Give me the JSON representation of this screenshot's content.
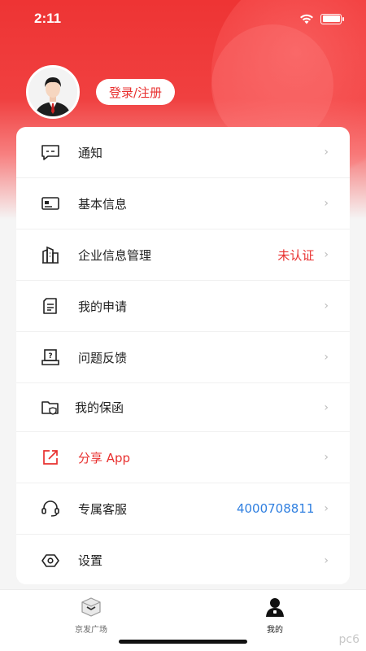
{
  "status_bar": {
    "time": "2:11"
  },
  "profile": {
    "login_label": "登录/注册"
  },
  "menu": [
    {
      "label": "通知",
      "value": "",
      "icon": "message-icon"
    },
    {
      "label": "基本信息",
      "value": "",
      "icon": "id-card-icon"
    },
    {
      "label": "企业信息管理",
      "value": "未认证",
      "value_color": "#e8302f",
      "icon": "building-icon"
    },
    {
      "label": "我的申请",
      "value": "",
      "icon": "document-icon"
    },
    {
      "label": "问题反馈",
      "value": "",
      "icon": "feedback-icon"
    },
    {
      "label": "我的保函",
      "value": "",
      "icon": "folder-shield-icon"
    },
    {
      "label": "分享 App",
      "value": "",
      "label_color": "#e8302f",
      "icon": "share-icon"
    },
    {
      "label": "专属客服",
      "value": "4000708811",
      "value_color": "#2f7fe0",
      "icon": "headset-icon"
    },
    {
      "label": "设置",
      "value": "",
      "icon": "settings-icon"
    }
  ],
  "tabbar": {
    "tabs": [
      {
        "label": "京发广场",
        "icon": "square-box-icon",
        "active": false
      },
      {
        "label": "我的",
        "icon": "person-icon",
        "active": true
      }
    ]
  },
  "watermark": "pc6",
  "colors": {
    "brand_red": "#e8302f",
    "link_blue": "#2f7fe0"
  }
}
